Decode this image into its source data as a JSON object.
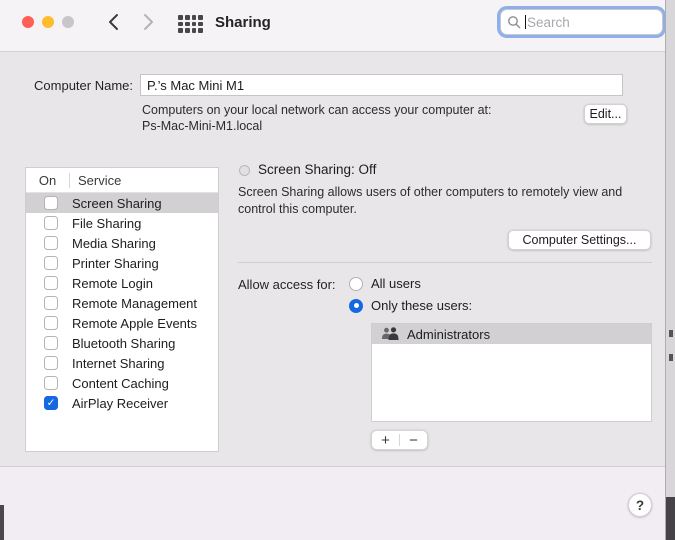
{
  "titlebar": {
    "title": "Sharing",
    "search_placeholder": "Search",
    "back_label": "back",
    "forward_label": "forward"
  },
  "computer_name": {
    "label": "Computer Name:",
    "value": "P.’s Mac Mini M1",
    "description_line1": "Computers on your local network can access your computer at:",
    "description_line2": "Ps-Mac-Mini-M1.local",
    "edit_button": "Edit..."
  },
  "service_list": {
    "columns": {
      "on": "On",
      "service": "Service"
    },
    "items": [
      {
        "label": "Screen Sharing",
        "checked": false,
        "selected": true
      },
      {
        "label": "File Sharing",
        "checked": false,
        "selected": false
      },
      {
        "label": "Media Sharing",
        "checked": false,
        "selected": false
      },
      {
        "label": "Printer Sharing",
        "checked": false,
        "selected": false
      },
      {
        "label": "Remote Login",
        "checked": false,
        "selected": false
      },
      {
        "label": "Remote Management",
        "checked": false,
        "selected": false
      },
      {
        "label": "Remote Apple Events",
        "checked": false,
        "selected": false
      },
      {
        "label": "Bluetooth Sharing",
        "checked": false,
        "selected": false
      },
      {
        "label": "Internet Sharing",
        "checked": false,
        "selected": false
      },
      {
        "label": "Content Caching",
        "checked": false,
        "selected": false
      },
      {
        "label": "AirPlay Receiver",
        "checked": true,
        "selected": false
      }
    ]
  },
  "screen_sharing": {
    "status": "Screen Sharing: Off",
    "description": "Screen Sharing allows users of other computers to remotely view and control this computer.",
    "computer_settings_button": "Computer Settings..."
  },
  "allow_access": {
    "label": "Allow access for:",
    "options": [
      {
        "label": "All users",
        "selected": false
      },
      {
        "label": "Only these users:",
        "selected": true
      }
    ],
    "users": [
      {
        "name": "Administrators"
      }
    ],
    "add_button": "+",
    "remove_button": "−"
  },
  "footer": {
    "help_button": "?"
  },
  "colors": {
    "accent_blue": "#1568e2",
    "selected_row": "#d2d0d2",
    "titlebar_bg": "#f6f3f6",
    "content_bg": "#e8e6e8",
    "footer_bg": "#f1edf3",
    "focus_ring": "#7aa3eb",
    "traffic_red": "#ff5f57",
    "traffic_yellow": "#febc2e",
    "traffic_gray": "#c8c6c8"
  }
}
